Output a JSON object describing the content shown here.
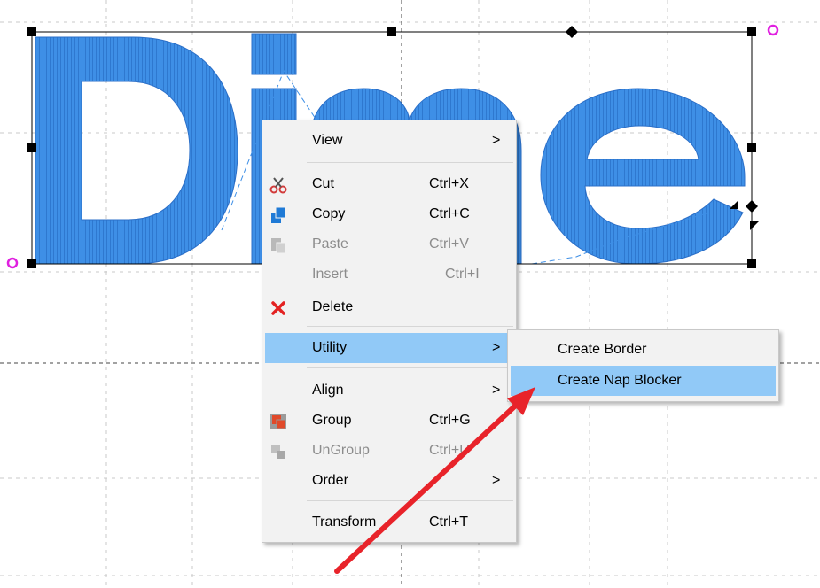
{
  "canvas": {
    "text": "Dime",
    "thread_color": "#3e8fe6",
    "handle_color": "#e020e0"
  },
  "context_menu": {
    "items": [
      {
        "label": "View",
        "shortcut": "",
        "submenu": true,
        "icon": "",
        "disabled": false
      },
      {
        "label": "Cut",
        "shortcut": "Ctrl+X",
        "submenu": false,
        "icon": "scissors-icon",
        "disabled": false
      },
      {
        "label": "Copy",
        "shortcut": "Ctrl+C",
        "submenu": false,
        "icon": "copy-icon",
        "disabled": false
      },
      {
        "label": "Paste",
        "shortcut": "Ctrl+V",
        "submenu": false,
        "icon": "paste-icon",
        "disabled": true
      },
      {
        "label": "Insert",
        "shortcut": "Ctrl+I",
        "submenu": false,
        "icon": "",
        "disabled": true
      },
      {
        "label": "Delete",
        "shortcut": "",
        "submenu": false,
        "icon": "delete-icon",
        "disabled": false
      },
      {
        "label": "Utility",
        "shortcut": "",
        "submenu": true,
        "icon": "",
        "disabled": false,
        "highlighted": true
      },
      {
        "label": "Align",
        "shortcut": "",
        "submenu": true,
        "icon": "",
        "disabled": false
      },
      {
        "label": "Group",
        "shortcut": "Ctrl+G",
        "submenu": false,
        "icon": "group-icon",
        "disabled": false
      },
      {
        "label": "UnGroup",
        "shortcut": "Ctrl+U",
        "submenu": false,
        "icon": "ungroup-icon",
        "disabled": true
      },
      {
        "label": "Order",
        "shortcut": "",
        "submenu": true,
        "icon": "",
        "disabled": false
      },
      {
        "label": "Transform",
        "shortcut": "Ctrl+T",
        "submenu": false,
        "icon": "",
        "disabled": false
      }
    ],
    "submenu_arrow": ">"
  },
  "utility_submenu": {
    "items": [
      {
        "label": "Create Border",
        "highlighted": false
      },
      {
        "label": "Create Nap Blocker",
        "highlighted": true
      }
    ]
  },
  "annotation": {
    "arrow_color": "#e8232a"
  },
  "colors": {
    "menu_bg": "#f2f2f2",
    "highlight": "#91c9f7",
    "disabled_text": "#8c8c8c",
    "grid": "#c8c8c8"
  }
}
